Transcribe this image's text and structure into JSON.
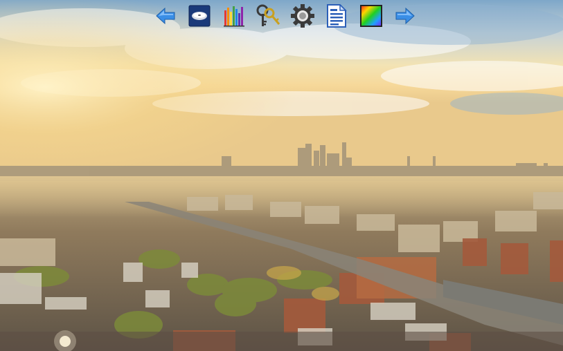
{
  "desktop": {
    "wallpaper": "city-skyline-sunset-photo"
  },
  "toolbar": {
    "items": [
      {
        "name": "back-arrow-icon",
        "icon": "arrow-left",
        "color": "#3a8ee6"
      },
      {
        "name": "disk-icon",
        "icon": "disk-drive",
        "color": "#1a3a7a"
      },
      {
        "name": "bar-chart-icon",
        "icon": "colored-bars",
        "color": "#6a3fb0"
      },
      {
        "name": "keys-icon",
        "icon": "keys",
        "color": "#c9a020"
      },
      {
        "name": "gear-icon",
        "icon": "gear",
        "color": "#2a2a2a"
      },
      {
        "name": "document-icon",
        "icon": "document",
        "color": "#2b5fb8"
      },
      {
        "name": "color-palette-icon",
        "icon": "spectrum-square",
        "color": "#e03030"
      },
      {
        "name": "forward-arrow-icon",
        "icon": "arrow-right",
        "color": "#3a8ee6"
      }
    ]
  }
}
